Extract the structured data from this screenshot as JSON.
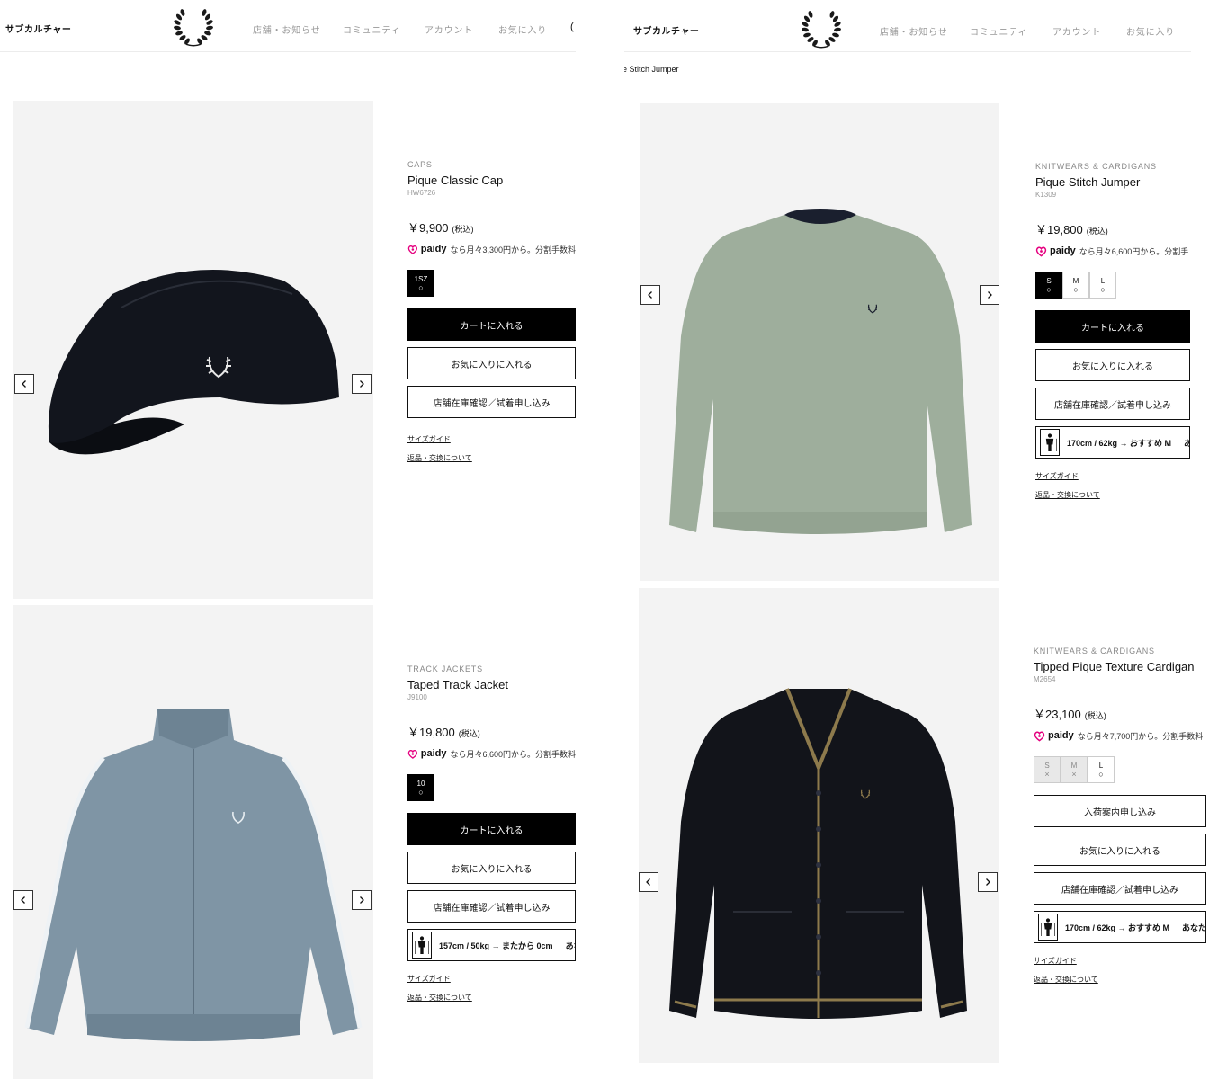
{
  "header": {
    "subculture": "サブカルチャー",
    "nav": [
      "店舗・お知らせ",
      "コミュニティ",
      "アカウント",
      "お気に入り"
    ],
    "cut_glyph": "("
  },
  "breadcrumb": "e Stitch Jumper",
  "products": [
    {
      "category": "CAPS",
      "name": "Pique Classic Cap",
      "sku": "HW6726",
      "price": "￥9,900",
      "tax": "(税込)",
      "paidy_brand": "paidy",
      "paidy_text": "なら月々3,300円から。分割手数料",
      "sizes": [
        {
          "label": "1SZ",
          "mark": "○",
          "state": "selected"
        }
      ],
      "buttons": [
        "カートに入れる",
        "お気に入りに入れる",
        "店舗在庫確認／試着申し込み"
      ],
      "fit": null,
      "links": [
        "サイズガイド",
        "返品・交換について"
      ]
    },
    {
      "category": "TRACK JACKETS",
      "name": "Taped Track Jacket",
      "sku": "J9100",
      "price": "￥19,800",
      "tax": "(税込)",
      "paidy_brand": "paidy",
      "paidy_text": "なら月々6,600円から。分割手数料",
      "sizes": [
        {
          "label": "10",
          "mark": "○",
          "state": "selected"
        }
      ],
      "buttons": [
        "カートに入れる",
        "お気に入りに入れる",
        "店舗在庫確認／試着申し込み"
      ],
      "fit": {
        "text": "157cm / 50kg → またから 0cm",
        "more": "あな"
      },
      "links": [
        "サイズガイド",
        "返品・交換について"
      ]
    },
    {
      "category": "KNITWEARS & CARDIGANS",
      "name": "Pique Stitch Jumper",
      "sku": "K1309",
      "price": "￥19,800",
      "tax": "(税込)",
      "paidy_brand": "paidy",
      "paidy_text": "なら月々6,600円から。分割手",
      "sizes": [
        {
          "label": "S",
          "mark": "○",
          "state": "selected"
        },
        {
          "label": "M",
          "mark": "○",
          "state": "available"
        },
        {
          "label": "L",
          "mark": "○",
          "state": "available"
        }
      ],
      "buttons": [
        "カートに入れる",
        "お気に入りに入れる",
        "店舗在庫確認／試着申し込み"
      ],
      "fit": {
        "text": "170cm / 62kg → おすすめ M",
        "more": "あ"
      },
      "links": [
        "サイズガイド",
        "返品・交換について"
      ]
    },
    {
      "category": "KNITWEARS & CARDIGANS",
      "name": "Tipped Pique Texture Cardigan",
      "sku": "M2654",
      "price": "￥23,100",
      "tax": "(税込)",
      "paidy_brand": "paidy",
      "paidy_text": "なら月々7,700円から。分割手数料",
      "sizes": [
        {
          "label": "S",
          "mark": "×",
          "state": "soldout"
        },
        {
          "label": "M",
          "mark": "×",
          "state": "soldout"
        },
        {
          "label": "L",
          "mark": "○",
          "state": "available"
        }
      ],
      "buttons": [
        "入荷案内申し込み",
        "お気に入りに入れる",
        "店舗在庫確認／試着申し込み"
      ],
      "fit": {
        "text": "170cm / 62kg → おすすめ M",
        "more": "あなたは"
      },
      "links": [
        "サイズガイド",
        "返品・交換について"
      ]
    }
  ],
  "colors": {
    "accent": "#000000",
    "paidy": "#e5007f",
    "cap": "#12151d",
    "jacket": "#7f95a5",
    "jumper": "#9eae9c",
    "cardigan": "#12141a",
    "tipping": "#8d7a4c"
  },
  "icons": [
    "laurel-logo-icon",
    "chevron-left-icon",
    "chevron-right-icon",
    "paidy-heart-icon",
    "fit-figure-icon"
  ]
}
